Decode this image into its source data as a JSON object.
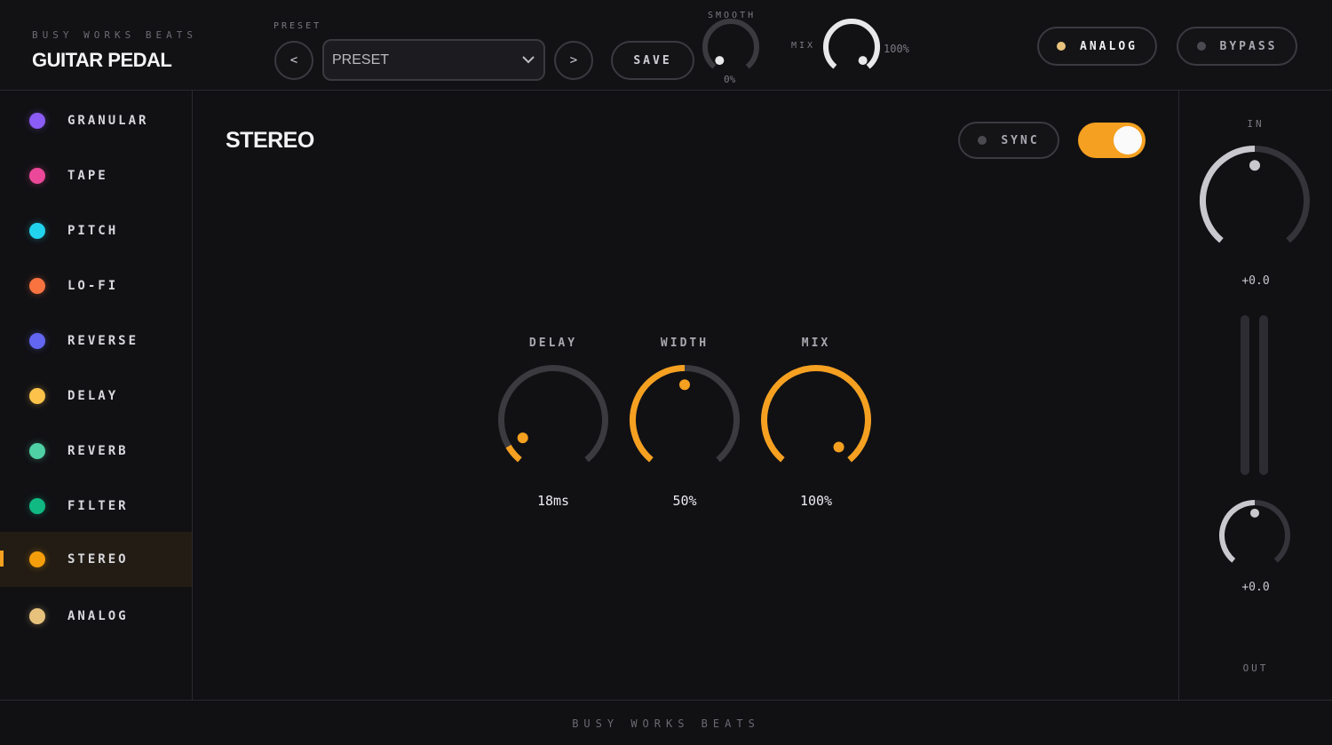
{
  "header": {
    "brand_sub": "BUSY WORKS BEATS",
    "brand_title": "GUITAR PEDAL",
    "preset_label": "PRESET",
    "prev_label": "<",
    "next_label": ">",
    "preset_value": "PRESET",
    "save_label": "SAVE",
    "smooth_label": "SMOOTH",
    "smooth_value": "0%",
    "smooth_level": 0.0,
    "mix_label": "MIX",
    "mix_value": "100%",
    "mix_level": 1.0,
    "analog_label": "ANALOG",
    "bypass_label": "BYPASS"
  },
  "sidebar": {
    "items": [
      {
        "label": "GRANULAR",
        "color": "#8b5cf6",
        "active": false
      },
      {
        "label": "TAPE",
        "color": "#ec4899",
        "active": false
      },
      {
        "label": "PITCH",
        "color": "#22d3ee",
        "active": false
      },
      {
        "label": "LO-FI",
        "color": "#f97340",
        "active": false
      },
      {
        "label": "REVERSE",
        "color": "#6366f1",
        "active": false
      },
      {
        "label": "DELAY",
        "color": "#fcc24a",
        "active": false
      },
      {
        "label": "REVERB",
        "color": "#4fd1a5",
        "active": false
      },
      {
        "label": "FILTER",
        "color": "#10b981",
        "active": false
      },
      {
        "label": "STEREO",
        "color": "#f59e0b",
        "active": true
      },
      {
        "label": "ANALOG",
        "color": "#e7c27d",
        "active": false
      }
    ]
  },
  "main": {
    "title": "STEREO",
    "sync_label": "SYNC",
    "enabled": true,
    "knobs": [
      {
        "label": "DELAY",
        "value": "18ms",
        "level": 0.07
      },
      {
        "label": "WIDTH",
        "value": "50%",
        "level": 0.5
      },
      {
        "label": "MIX",
        "value": "100%",
        "level": 1.0
      }
    ]
  },
  "io": {
    "in_label": "IN",
    "in_value": "+0.0",
    "in_level": 0.5,
    "out_value": "+0.0",
    "out_level": 0.5,
    "out_label": "OUT"
  },
  "footer": {
    "text": "BUSY WORKS BEATS"
  },
  "colors": {
    "accent": "#f5a020",
    "track": "#3a3a3f",
    "analog_dot": "#e7c27d",
    "inactive_dot": "#4a4a50"
  }
}
